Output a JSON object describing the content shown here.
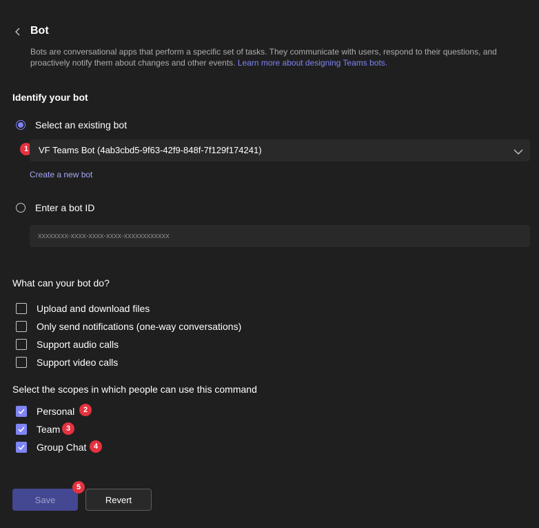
{
  "header": {
    "title": "Bot",
    "description": "Bots are conversational apps that perform a specific set of tasks. They communicate with users, respond to their questions, and proactively notify them about changes and other events.",
    "learn_more_link": "Learn more about designing Teams bots."
  },
  "identify": {
    "heading": "Identify your bot",
    "option_existing": "Select an existing bot",
    "selected_bot": "VF Teams Bot (4ab3cbd5-9f63-42f9-848f-7f129f174241)",
    "create_link": "Create a new bot",
    "option_enter_id": "Enter a bot ID",
    "bot_id_placeholder": "xxxxxxxx-xxxx-xxxx-xxxx-xxxxxxxxxxxx"
  },
  "capabilities": {
    "heading": "What can your bot do?",
    "items": [
      {
        "label": "Upload and download files",
        "checked": false
      },
      {
        "label": "Only send notifications (one-way conversations)",
        "checked": false
      },
      {
        "label": "Support audio calls",
        "checked": false
      },
      {
        "label": "Support video calls",
        "checked": false
      }
    ]
  },
  "scopes": {
    "heading": "Select the scopes in which people can use this command",
    "items": [
      {
        "label": "Personal",
        "checked": true
      },
      {
        "label": "Team",
        "checked": true
      },
      {
        "label": "Group Chat",
        "checked": true
      }
    ]
  },
  "badges": [
    "1",
    "2",
    "3",
    "4",
    "5"
  ],
  "actions": {
    "save_label": "Save",
    "revert_label": "Revert"
  },
  "colors": {
    "background": "#1f1f1f",
    "accent": "#7f85f5",
    "badge": "#e5323f"
  }
}
